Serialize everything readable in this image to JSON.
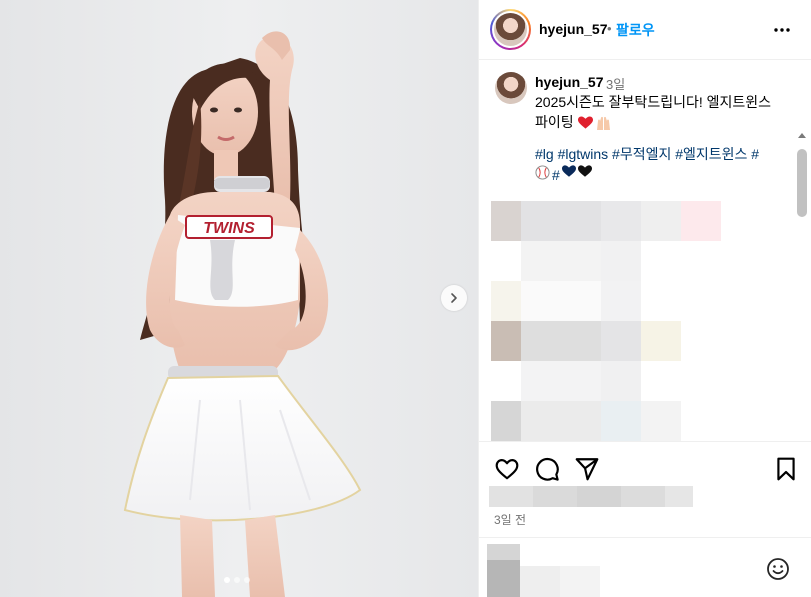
{
  "post": {
    "author": "hyejun_57",
    "header_separator": "•",
    "follow_label": "팔로우",
    "caption_time": "3일",
    "caption_text": "2025시즌도 잘부탁드립니다! 엘지트윈스 파이팅",
    "caption_emojis": [
      "red-heart",
      "raised-hands"
    ],
    "hashtags": "#lg #lgtwins #무적엘지 #엘지트윈스 #",
    "hashtag_emojis": [
      "baseball",
      "#",
      "blue-heart",
      "black-heart"
    ],
    "date_label": "3일 전",
    "uniform_text": "TWINS"
  },
  "media": {
    "carousel_count": 3,
    "carousel_active": 0,
    "next_icon": "chevron-right-icon"
  },
  "icons": {
    "more": "more-horizontal-icon",
    "like": "heart-outline-icon",
    "comment": "comment-bubble-icon",
    "share": "paper-plane-icon",
    "save": "bookmark-icon",
    "emoji": "smiley-icon"
  },
  "colors": {
    "follow": "#0095f6",
    "hashtag": "#00376b",
    "muted": "#737373",
    "divider": "#efefef"
  }
}
